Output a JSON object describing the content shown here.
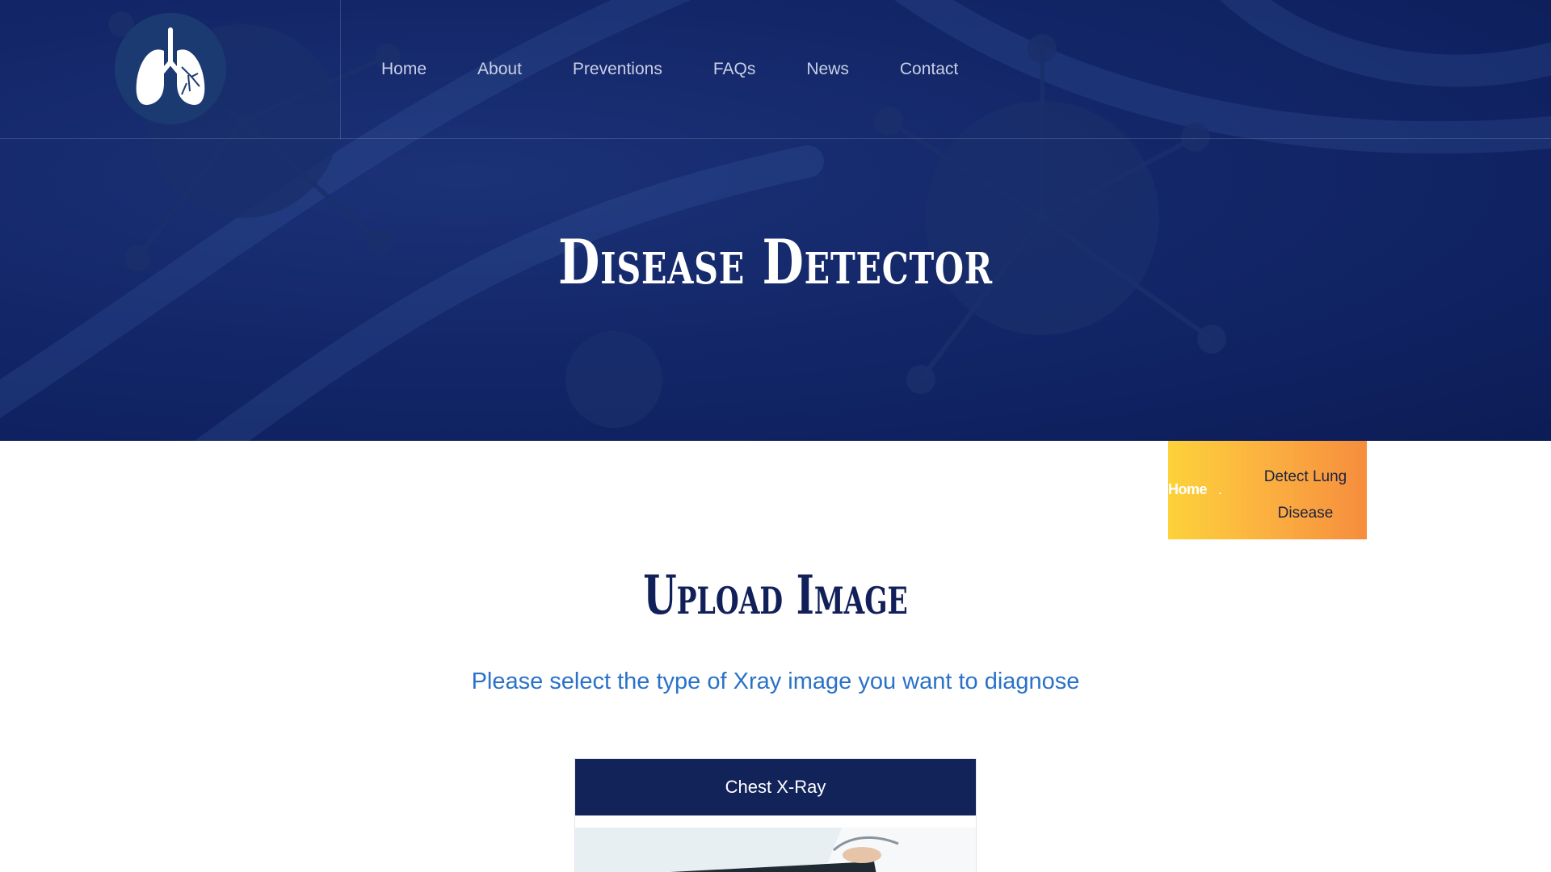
{
  "header": {
    "logo": {
      "icon": "lungs-icon"
    },
    "nav": [
      {
        "label": "Home"
      },
      {
        "label": "About"
      },
      {
        "label": "Preventions"
      },
      {
        "label": "FAQs"
      },
      {
        "label": "News"
      },
      {
        "label": "Contact"
      }
    ]
  },
  "hero": {
    "title": "Disease Detector"
  },
  "breadcrumb": {
    "home": "Home",
    "separator": ".",
    "current": "Detect Lung Disease"
  },
  "main": {
    "title": "Upload Image",
    "subtitle": "Please select the type of Xray image you want to diagnose",
    "cards": [
      {
        "label": "Chest X-Ray",
        "image": "doctor-holding-xray"
      }
    ]
  },
  "colors": {
    "hero_bg": "#14286a",
    "navy": "#12235a",
    "accent_blue": "#2a72c8",
    "breadcrumb_gradient_start": "#fdd23a",
    "breadcrumb_gradient_end": "#f68d3d"
  }
}
